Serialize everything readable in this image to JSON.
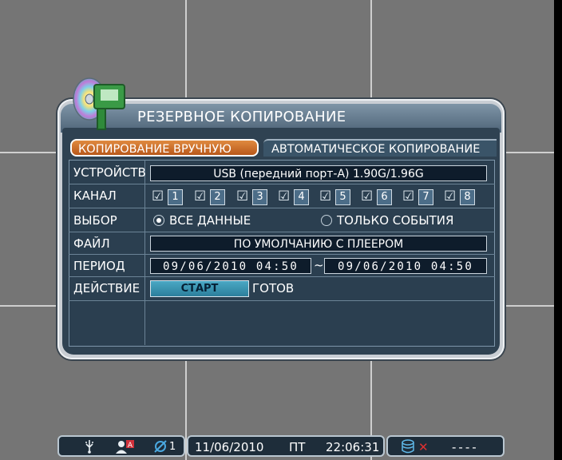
{
  "dialog": {
    "title": "РЕЗЕРВНОЕ КОПИРОВАНИЕ",
    "tabs": [
      {
        "label": "КОПИРОВАНИЕ ВРУЧНУЮ",
        "active": true
      },
      {
        "label": "АВТОМАТИЧЕСКОЕ КОПИРОВАНИЕ",
        "active": false
      }
    ],
    "rows": {
      "device": {
        "label": "УСТРОЙСТВО",
        "value": "USB (передний порт-A) 1.90G/1.96G"
      },
      "channel": {
        "label": "КАНАЛ",
        "channels": [
          "1",
          "2",
          "3",
          "4",
          "5",
          "6",
          "7",
          "8"
        ],
        "checked": [
          true,
          true,
          true,
          true,
          true,
          true,
          true,
          true
        ]
      },
      "selection": {
        "label": "ВЫБОР",
        "options": [
          "ВСЕ ДАННЫЕ",
          "ТОЛЬКО СОБЫТИЯ"
        ],
        "selected": "ВСЕ ДАННЫЕ"
      },
      "file": {
        "label": "ФАЙЛ",
        "value": "ПО УМОЛЧАНИЮ С ПЛЕЕРОМ"
      },
      "period": {
        "label": "ПЕРИОД",
        "from": "09/06/2010 04:50",
        "separator": "~",
        "to": "09/06/2010 04:50"
      },
      "action": {
        "label": "ДЕЙСТВИЕ",
        "button": "СТАРТ",
        "status": "ГОТОВ"
      }
    }
  },
  "statusbar": {
    "camera_count": "1",
    "date": "11/06/2010",
    "weekday": "ПТ",
    "time": "22:06:31",
    "disk_status": "----"
  },
  "icons": {
    "logo": "backup-disc-icon",
    "usb": "usb-icon",
    "user": "user-icon",
    "camera": "camera-icon",
    "disk": "disk-icon",
    "error": "error-x-icon"
  },
  "colors": {
    "active_tab": "#c86a28",
    "panel": "#2b3f50",
    "field": "#0e1c2b",
    "start_button": "#3b95b2",
    "error": "#e03030"
  }
}
